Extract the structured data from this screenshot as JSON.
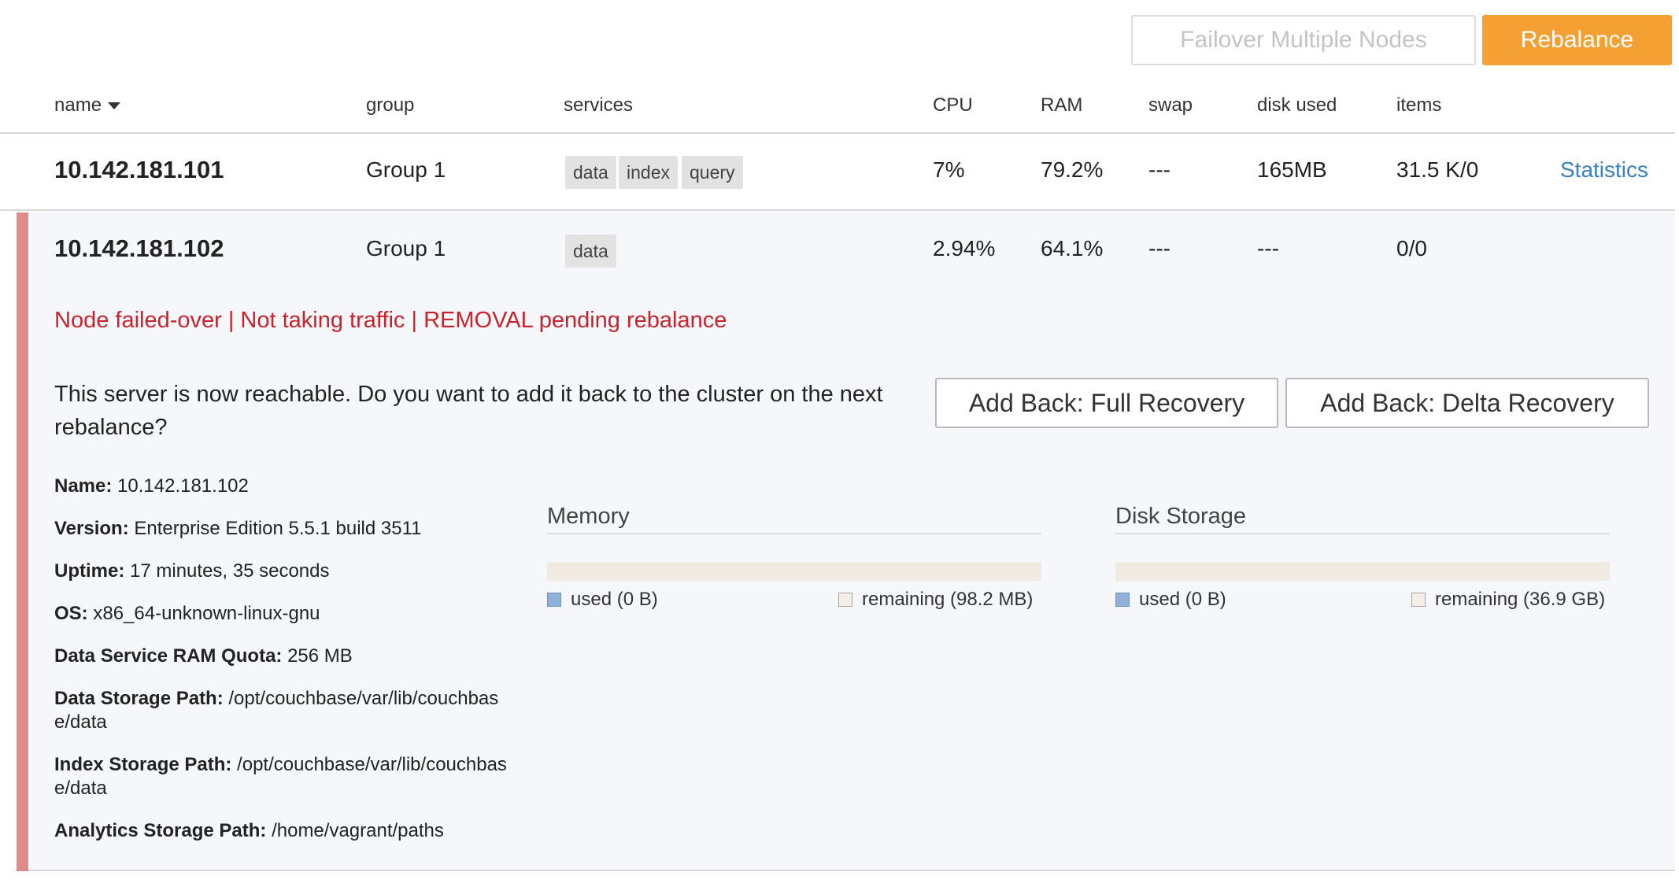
{
  "toolbar": {
    "failover_label": "Failover Multiple Nodes",
    "rebalance_label": "Rebalance"
  },
  "columns": {
    "name": "name",
    "group": "group",
    "services": "services",
    "cpu": "CPU",
    "ram": "RAM",
    "swap": "swap",
    "disk": "disk used",
    "items": "items"
  },
  "nodes": [
    {
      "name": "10.142.181.101",
      "group": "Group 1",
      "services": [
        "data",
        "index",
        "query"
      ],
      "cpu": "7%",
      "ram": "79.2%",
      "swap": "---",
      "disk": "165MB",
      "items": "31.5 K/0",
      "link": "Statistics",
      "status_color": "#78c27a"
    },
    {
      "name": "10.142.181.102",
      "group": "Group 1",
      "services": [
        "data"
      ],
      "cpu": "2.94%",
      "ram": "64.1%",
      "swap": "---",
      "disk": "---",
      "items": "0/0",
      "status_color": "#e08a8a",
      "status_text": "Node failed-over | Not taking traffic | REMOVAL pending rebalance",
      "prompt": "This server is now reachable. Do you want to add it back to the cluster on the next rebalance?",
      "full_recovery_label": "Add Back: Full Recovery",
      "delta_recovery_label": "Add Back: Delta Recovery",
      "details": {
        "name_label": "Name:",
        "name_value": "10.142.181.102",
        "version_label": "Version:",
        "version_value": "Enterprise Edition 5.5.1 build 3511",
        "uptime_label": "Uptime:",
        "uptime_value": "17 minutes, 35 seconds",
        "os_label": "OS:",
        "os_value": "x86_64-unknown-linux-gnu",
        "quota_label": "Data Service RAM Quota:",
        "quota_value": "256 MB",
        "data_path_label": "Data Storage Path:",
        "data_path_value": "/opt/couchbase/var/lib/couchbase/data",
        "index_path_label": "Index Storage Path:",
        "index_path_value": "/opt/couchbase/var/lib/couchbase/data",
        "analytics_path_label": "Analytics Storage Path:",
        "analytics_path_value": "/home/vagrant/paths"
      },
      "memory": {
        "title": "Memory",
        "used_label": "used (0 B)",
        "remaining_label": "remaining (98.2 MB)",
        "used_fraction": 0
      },
      "disk_storage": {
        "title": "Disk Storage",
        "used_label": "used (0 B)",
        "remaining_label": "remaining (36.9 GB)",
        "used_fraction": 0
      }
    }
  ]
}
